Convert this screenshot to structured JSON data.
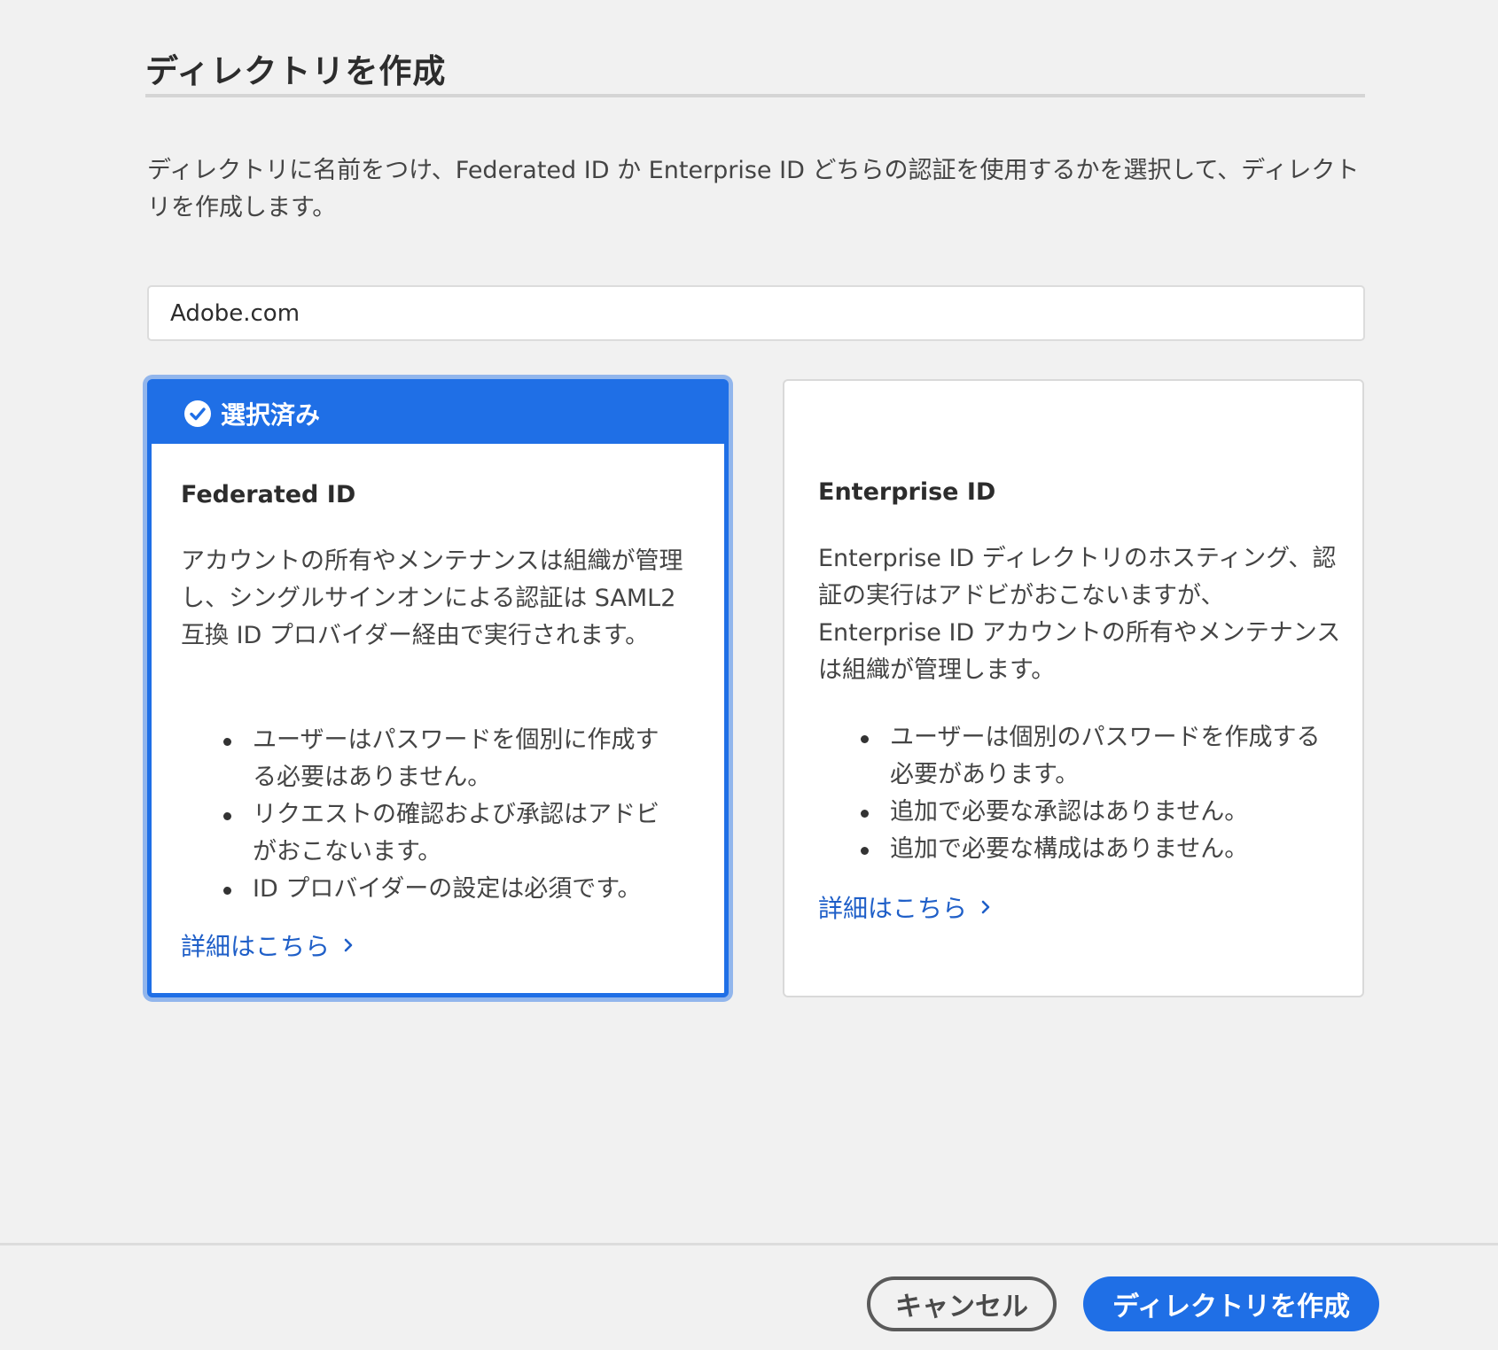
{
  "dialog": {
    "title": "ディレクトリを作成",
    "description": "ディレクトリに名前をつけ、Federated ID か Enterprise ID どちらの認証を使用するかを選択して、ディレクトリを作成します。"
  },
  "name_input": {
    "value": "Adobe.com"
  },
  "cards": {
    "federated": {
      "selected": true,
      "selected_label": "選択済み",
      "title": "Federated ID",
      "body": "アカウントの所有やメンテナンスは組織が管理し、シングルサインオンによる認証は SAML2 互換 ID プロバイダー経由で実行されます。",
      "bullets": [
        "ユーザーはパスワードを個別に作成する必要はありません。",
        "リクエストの確認および承認はアドビがおこないます。",
        "ID プロバイダーの設定は必須です。"
      ],
      "learn_more": "詳細はこちら"
    },
    "enterprise": {
      "selected": false,
      "title": "Enterprise ID",
      "body": "Enterprise ID ディレクトリのホスティング、認証の実行はアドビがおこないますが、Enterprise ID アカウントの所有やメンテナンスは組織が管理します。",
      "bullets": [
        "ユーザーは個別のパスワードを作成する必要があります。",
        "追加で必要な承認はありません。",
        "追加で必要な構成はありません。"
      ],
      "learn_more": "詳細はこちら"
    }
  },
  "footer": {
    "cancel_label": "キャンセル",
    "create_label": "ディレクトリを作成"
  },
  "icons": {
    "selected": "checkmark-circle-icon",
    "learn_more": "chevron-right-icon"
  },
  "colors": {
    "accent": "#1f6fe6",
    "link": "#1f5fc8",
    "background": "#f1f1f1"
  }
}
